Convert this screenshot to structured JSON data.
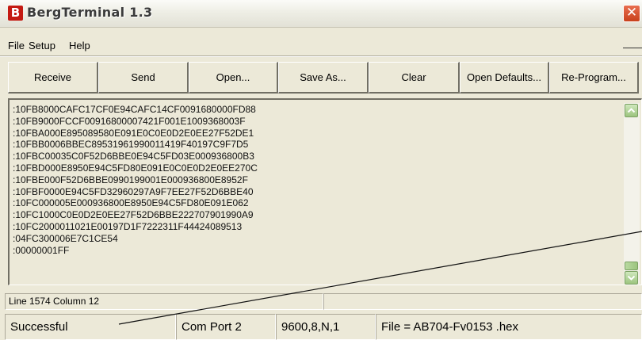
{
  "window": {
    "title": "BergTerminal 1.3",
    "app_icon_letter": "B",
    "close_glyph": "✕"
  },
  "menu": [
    "File",
    "Setup",
    "Help"
  ],
  "toolbar": {
    "receive": "Receive",
    "send": "Send",
    "open": "Open...",
    "save_as": "Save As...",
    "clear": "Clear",
    "open_defaults": "Open Defaults...",
    "reprogram": "Re-Program..."
  },
  "editor": {
    "lines": [
      ":10FB8000CAFC17CF0E94CAFC14CF0091680000FD88",
      ":10FB9000FCCF00916800007421F001E1009368003F",
      ":10FBA000E895089580E091E0C0E0D2E0EE27F52DE1",
      ":10FBB0006BBEC89531961990011419F40197C9F7D5",
      ":10FBC00035C0F52D6BBE0E94C5FD03E000936800B3",
      ":10FBD000E8950E94C5FD80E091E0C0E0D2E0EE270C",
      ":10FBE000F52D6BBE0990199001E000936800E8952F",
      ":10FBF0000E94C5FD32960297A9F7EE27F52D6BBE40",
      ":10FC000005E000936800E8950E94C5FD80E091E062",
      ":10FC1000C0E0D2E0EE27F52D6BBE222707901990A9",
      ":10FC2000011021E00197D1F7222311F44424089513",
      ":04FC300006E7C1CE54",
      ":00000001FF"
    ]
  },
  "status": {
    "position": "Line 1574 Column 12",
    "result": "Successful",
    "port": "Com Port 2",
    "settings": "9600,8,N,1",
    "file": "File = AB704-Fv0153 .hex"
  },
  "icons": {
    "scroll_up": "scroll-up-icon",
    "scroll_down": "scroll-down-icon",
    "accent_green": "#9cc47f",
    "close_red": "#c8411c",
    "brand_red": "#c41a12"
  }
}
